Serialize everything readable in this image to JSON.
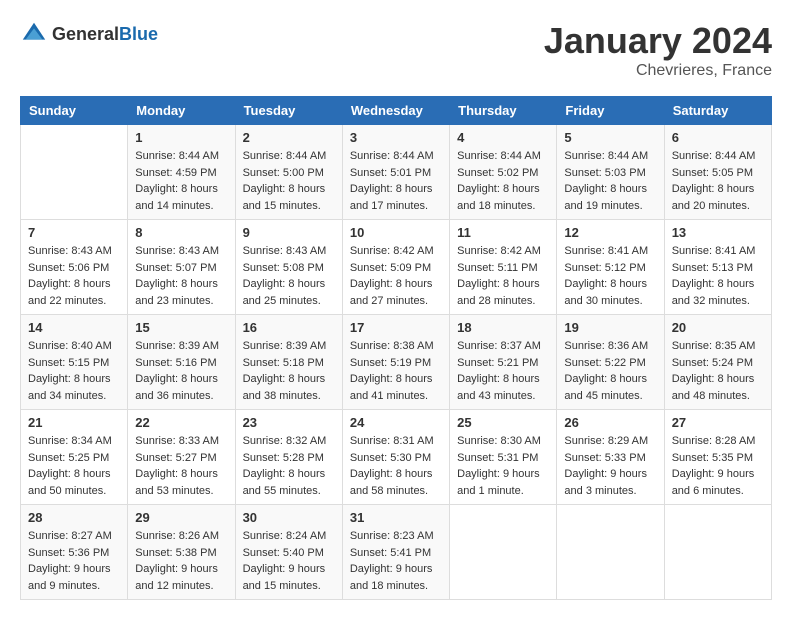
{
  "header": {
    "logo_general": "General",
    "logo_blue": "Blue",
    "month_year": "January 2024",
    "location": "Chevrieres, France"
  },
  "days_of_week": [
    "Sunday",
    "Monday",
    "Tuesday",
    "Wednesday",
    "Thursday",
    "Friday",
    "Saturday"
  ],
  "weeks": [
    [
      {
        "day": "",
        "sunrise": "",
        "sunset": "",
        "daylight": ""
      },
      {
        "day": "1",
        "sunrise": "Sunrise: 8:44 AM",
        "sunset": "Sunset: 4:59 PM",
        "daylight": "Daylight: 8 hours and 14 minutes."
      },
      {
        "day": "2",
        "sunrise": "Sunrise: 8:44 AM",
        "sunset": "Sunset: 5:00 PM",
        "daylight": "Daylight: 8 hours and 15 minutes."
      },
      {
        "day": "3",
        "sunrise": "Sunrise: 8:44 AM",
        "sunset": "Sunset: 5:01 PM",
        "daylight": "Daylight: 8 hours and 17 minutes."
      },
      {
        "day": "4",
        "sunrise": "Sunrise: 8:44 AM",
        "sunset": "Sunset: 5:02 PM",
        "daylight": "Daylight: 8 hours and 18 minutes."
      },
      {
        "day": "5",
        "sunrise": "Sunrise: 8:44 AM",
        "sunset": "Sunset: 5:03 PM",
        "daylight": "Daylight: 8 hours and 19 minutes."
      },
      {
        "day": "6",
        "sunrise": "Sunrise: 8:44 AM",
        "sunset": "Sunset: 5:05 PM",
        "daylight": "Daylight: 8 hours and 20 minutes."
      }
    ],
    [
      {
        "day": "7",
        "sunrise": "Sunrise: 8:43 AM",
        "sunset": "Sunset: 5:06 PM",
        "daylight": "Daylight: 8 hours and 22 minutes."
      },
      {
        "day": "8",
        "sunrise": "Sunrise: 8:43 AM",
        "sunset": "Sunset: 5:07 PM",
        "daylight": "Daylight: 8 hours and 23 minutes."
      },
      {
        "day": "9",
        "sunrise": "Sunrise: 8:43 AM",
        "sunset": "Sunset: 5:08 PM",
        "daylight": "Daylight: 8 hours and 25 minutes."
      },
      {
        "day": "10",
        "sunrise": "Sunrise: 8:42 AM",
        "sunset": "Sunset: 5:09 PM",
        "daylight": "Daylight: 8 hours and 27 minutes."
      },
      {
        "day": "11",
        "sunrise": "Sunrise: 8:42 AM",
        "sunset": "Sunset: 5:11 PM",
        "daylight": "Daylight: 8 hours and 28 minutes."
      },
      {
        "day": "12",
        "sunrise": "Sunrise: 8:41 AM",
        "sunset": "Sunset: 5:12 PM",
        "daylight": "Daylight: 8 hours and 30 minutes."
      },
      {
        "day": "13",
        "sunrise": "Sunrise: 8:41 AM",
        "sunset": "Sunset: 5:13 PM",
        "daylight": "Daylight: 8 hours and 32 minutes."
      }
    ],
    [
      {
        "day": "14",
        "sunrise": "Sunrise: 8:40 AM",
        "sunset": "Sunset: 5:15 PM",
        "daylight": "Daylight: 8 hours and 34 minutes."
      },
      {
        "day": "15",
        "sunrise": "Sunrise: 8:39 AM",
        "sunset": "Sunset: 5:16 PM",
        "daylight": "Daylight: 8 hours and 36 minutes."
      },
      {
        "day": "16",
        "sunrise": "Sunrise: 8:39 AM",
        "sunset": "Sunset: 5:18 PM",
        "daylight": "Daylight: 8 hours and 38 minutes."
      },
      {
        "day": "17",
        "sunrise": "Sunrise: 8:38 AM",
        "sunset": "Sunset: 5:19 PM",
        "daylight": "Daylight: 8 hours and 41 minutes."
      },
      {
        "day": "18",
        "sunrise": "Sunrise: 8:37 AM",
        "sunset": "Sunset: 5:21 PM",
        "daylight": "Daylight: 8 hours and 43 minutes."
      },
      {
        "day": "19",
        "sunrise": "Sunrise: 8:36 AM",
        "sunset": "Sunset: 5:22 PM",
        "daylight": "Daylight: 8 hours and 45 minutes."
      },
      {
        "day": "20",
        "sunrise": "Sunrise: 8:35 AM",
        "sunset": "Sunset: 5:24 PM",
        "daylight": "Daylight: 8 hours and 48 minutes."
      }
    ],
    [
      {
        "day": "21",
        "sunrise": "Sunrise: 8:34 AM",
        "sunset": "Sunset: 5:25 PM",
        "daylight": "Daylight: 8 hours and 50 minutes."
      },
      {
        "day": "22",
        "sunrise": "Sunrise: 8:33 AM",
        "sunset": "Sunset: 5:27 PM",
        "daylight": "Daylight: 8 hours and 53 minutes."
      },
      {
        "day": "23",
        "sunrise": "Sunrise: 8:32 AM",
        "sunset": "Sunset: 5:28 PM",
        "daylight": "Daylight: 8 hours and 55 minutes."
      },
      {
        "day": "24",
        "sunrise": "Sunrise: 8:31 AM",
        "sunset": "Sunset: 5:30 PM",
        "daylight": "Daylight: 8 hours and 58 minutes."
      },
      {
        "day": "25",
        "sunrise": "Sunrise: 8:30 AM",
        "sunset": "Sunset: 5:31 PM",
        "daylight": "Daylight: 9 hours and 1 minute."
      },
      {
        "day": "26",
        "sunrise": "Sunrise: 8:29 AM",
        "sunset": "Sunset: 5:33 PM",
        "daylight": "Daylight: 9 hours and 3 minutes."
      },
      {
        "day": "27",
        "sunrise": "Sunrise: 8:28 AM",
        "sunset": "Sunset: 5:35 PM",
        "daylight": "Daylight: 9 hours and 6 minutes."
      }
    ],
    [
      {
        "day": "28",
        "sunrise": "Sunrise: 8:27 AM",
        "sunset": "Sunset: 5:36 PM",
        "daylight": "Daylight: 9 hours and 9 minutes."
      },
      {
        "day": "29",
        "sunrise": "Sunrise: 8:26 AM",
        "sunset": "Sunset: 5:38 PM",
        "daylight": "Daylight: 9 hours and 12 minutes."
      },
      {
        "day": "30",
        "sunrise": "Sunrise: 8:24 AM",
        "sunset": "Sunset: 5:40 PM",
        "daylight": "Daylight: 9 hours and 15 minutes."
      },
      {
        "day": "31",
        "sunrise": "Sunrise: 8:23 AM",
        "sunset": "Sunset: 5:41 PM",
        "daylight": "Daylight: 9 hours and 18 minutes."
      },
      {
        "day": "",
        "sunrise": "",
        "sunset": "",
        "daylight": ""
      },
      {
        "day": "",
        "sunrise": "",
        "sunset": "",
        "daylight": ""
      },
      {
        "day": "",
        "sunrise": "",
        "sunset": "",
        "daylight": ""
      }
    ]
  ]
}
